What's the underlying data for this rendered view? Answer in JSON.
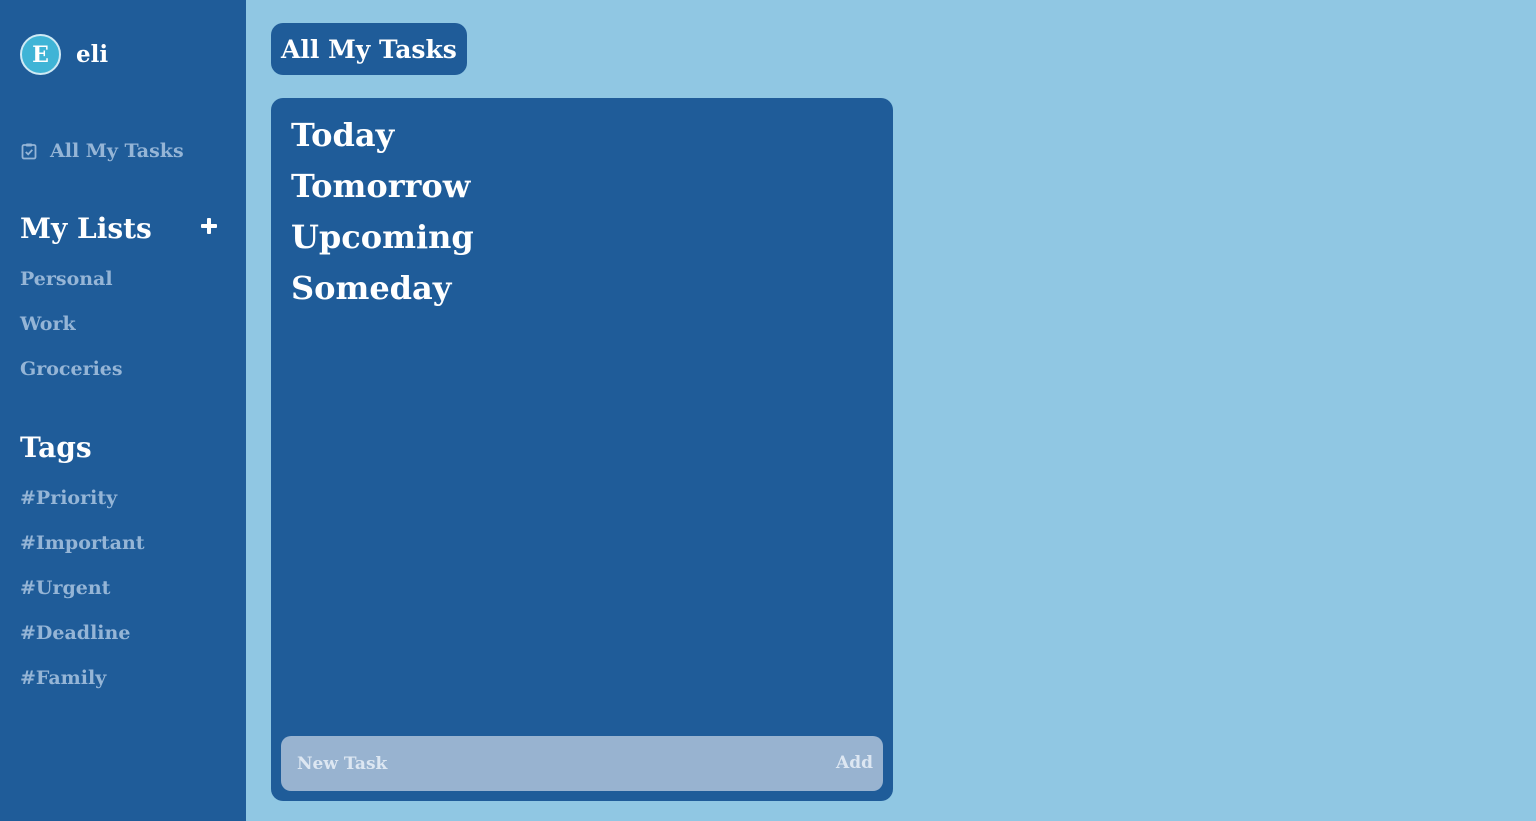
{
  "user": {
    "initial": "E",
    "name": "eli"
  },
  "nav": {
    "all_tasks": "All My Tasks"
  },
  "lists": {
    "title": "My Lists",
    "add_icon": "plus-icon",
    "items": [
      "Personal",
      "Work",
      "Groceries"
    ]
  },
  "tags": {
    "title": "Tags",
    "items": [
      "#Priority",
      "#Important",
      "#Urgent",
      "#Deadline",
      "#Family"
    ]
  },
  "main": {
    "title": "All My Tasks",
    "groups": [
      "Today",
      "Tomorrow",
      "Upcoming",
      "Someday"
    ],
    "new_task_placeholder": "New Task",
    "add_label": "Add"
  },
  "colors": {
    "background": "#90c7e3",
    "sidebar": "#1f5c99",
    "panel": "#1f5c99",
    "avatar": "#3fb4d6",
    "muted_text": "#95b5d6",
    "input_bg": "#98b3d0"
  }
}
